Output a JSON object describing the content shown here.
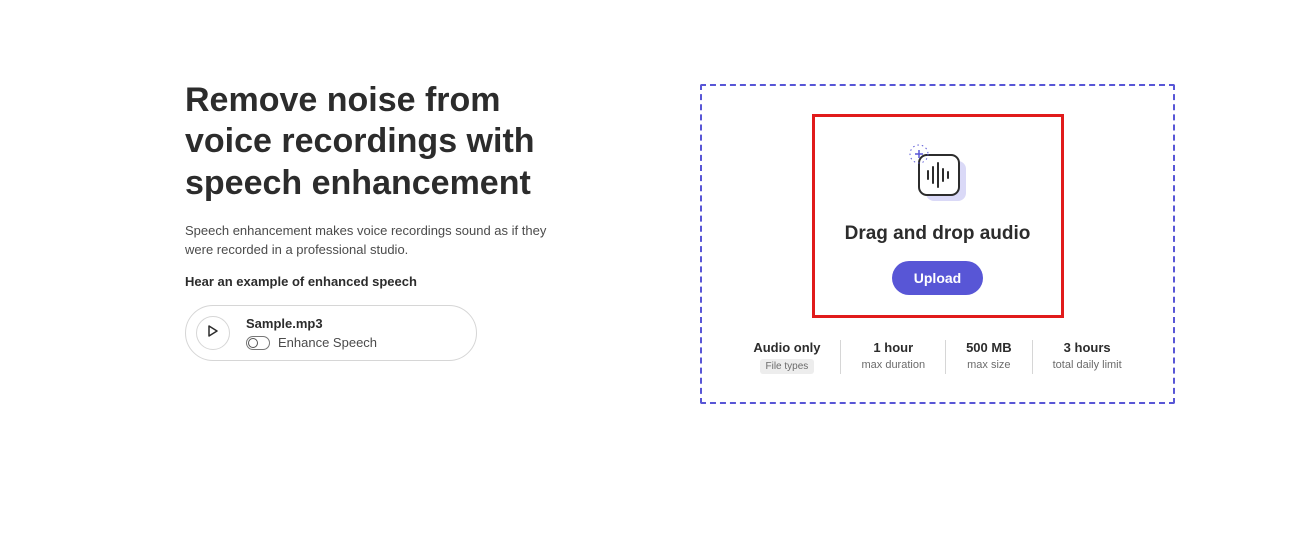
{
  "heading": "Remove noise from voice recordings with speech enhancement",
  "description": "Speech enhancement makes voice recordings sound as if they were recorded in a professional studio.",
  "example_label": "Hear an example of enhanced speech",
  "sample": {
    "filename": "Sample.mp3",
    "enhance_label": "Enhance Speech"
  },
  "dropzone": {
    "title": "Drag and drop audio",
    "upload_label": "Upload"
  },
  "limits": {
    "audio_only": {
      "value": "Audio only",
      "label": "File types"
    },
    "duration": {
      "value": "1 hour",
      "label": "max duration"
    },
    "size": {
      "value": "500 MB",
      "label": "max size"
    },
    "daily": {
      "value": "3 hours",
      "label": "total daily limit"
    }
  },
  "colors": {
    "accent": "#5856d6",
    "highlight_border": "#e11b1b"
  }
}
